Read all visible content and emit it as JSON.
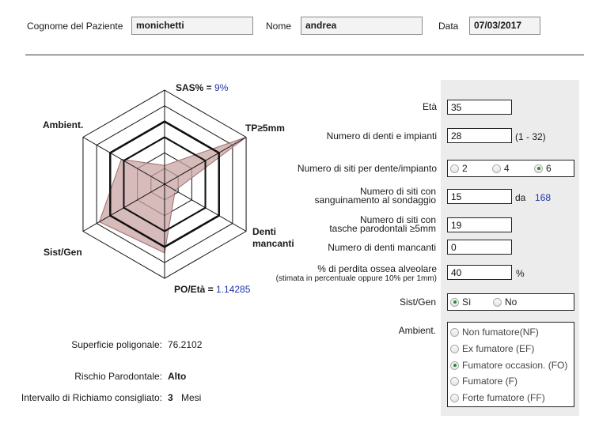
{
  "header": {
    "surname_label": "Cognome del Paziente",
    "surname_value": "monichetti",
    "name_label": "Nome",
    "name_value": "andrea",
    "date_label": "Data",
    "date_value": "07/03/2017"
  },
  "chart_data": {
    "type": "radar",
    "title": "",
    "axes": [
      {
        "key": "sas",
        "label": "SAS% =",
        "value_text": "9%"
      },
      {
        "key": "tp",
        "label": "TP≥5mm",
        "value_text": ""
      },
      {
        "key": "denti",
        "label_line1": "Denti",
        "label_line2": "mancanti",
        "value_text": ""
      },
      {
        "key": "po",
        "label": "PO/Età =",
        "value_text": "1.14285"
      },
      {
        "key": "sist",
        "label": "Sist/Gen",
        "value_text": ""
      },
      {
        "key": "ambient",
        "label": "Ambient.",
        "value_text": ""
      }
    ],
    "rings": 6,
    "polygon_values_fraction": [
      0.2,
      1.0,
      0.13,
      0.73,
      0.8,
      0.53
    ],
    "fill_color": "#c9a3a3",
    "stroke_color": "#9e6e6e"
  },
  "form": {
    "eta_label": "Età",
    "eta_value": "35",
    "denti_label": "Numero di denti e impianti",
    "denti_value": "28",
    "denti_range": "(1 - 32)",
    "siti_label": "Numero di siti per dente/impianto",
    "siti_options": [
      {
        "label": "2",
        "selected": false
      },
      {
        "label": "4",
        "selected": false
      },
      {
        "label": "6",
        "selected": true
      }
    ],
    "sanguinamento_label_line1": "Numero di siti con",
    "sanguinamento_label_line2": "sanguinamento al sondaggio",
    "sanguinamento_value": "15",
    "sanguinamento_da": "da",
    "sanguinamento_total": "168",
    "tasche_label_line1": "Numero di siti con",
    "tasche_label_line2": "tasche parodontali ≥5mm",
    "tasche_value": "19",
    "mancanti_label": "Numero di denti mancanti",
    "mancanti_value": "0",
    "perdita_label": "% di perdita ossea alveolare",
    "perdita_sublabel": "(stimata in percentuale oppure 10% per 1mm)",
    "perdita_value": "40",
    "perdita_unit": "%",
    "sist_label": "Sist/Gen",
    "sist_options": [
      {
        "label": "Sì",
        "selected": true
      },
      {
        "label": "No",
        "selected": false
      }
    ],
    "ambient_label": "Ambient.",
    "ambient_options": [
      {
        "label": "Non fumatore(NF)",
        "selected": false
      },
      {
        "label": "Ex fumatore (EF)",
        "selected": false
      },
      {
        "label": "Fumatore occasion. (FO)",
        "selected": true
      },
      {
        "label": "Fumatore (F)",
        "selected": false
      },
      {
        "label": "Forte fumatore (FF)",
        "selected": false
      }
    ]
  },
  "results": {
    "superficie_label": "Superficie poligonale:",
    "superficie_value": "76.2102",
    "rischio_label": "Rischio Parodontale:",
    "rischio_value": "Alto",
    "intervallo_label": "Intervallo di Richiamo consigliato:",
    "intervallo_value": "3",
    "intervallo_unit": "Mesi"
  }
}
